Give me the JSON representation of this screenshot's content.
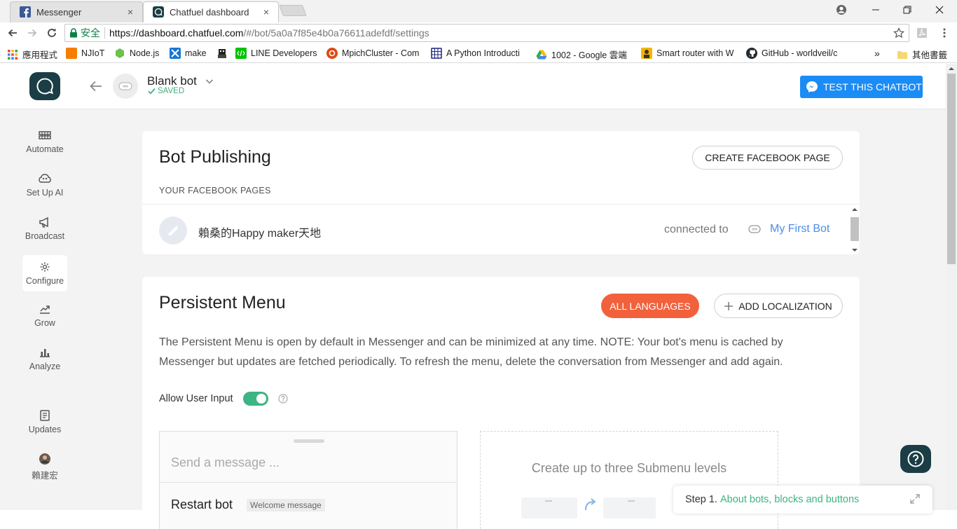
{
  "browser": {
    "tabs": [
      {
        "title": "Messenger",
        "close": "×",
        "active": false
      },
      {
        "title": "Chatfuel dashboard",
        "close": "×",
        "active": true
      }
    ],
    "address": {
      "secure_label": "安全",
      "url_host": "https://dashboard.chatfuel.com",
      "url_rest": "/#/bot/5a0a7f85e4b0a76611adefdf/settings"
    },
    "bookmarks": [
      {
        "label": "應用程式",
        "icon": "apps-grid-icon",
        "color": "#e8453c"
      },
      {
        "label": "NJIoT",
        "icon": "blogger-icon",
        "color": "#f57d00"
      },
      {
        "label": "Node.js",
        "icon": "nodejs-icon",
        "color": "#6cc24a"
      },
      {
        "label": "make",
        "icon": "bookmark-blue-icon",
        "color": "#1976d2"
      },
      {
        "label": "",
        "icon": "pixel-art-icon",
        "color": "#333333"
      },
      {
        "label": "LINE Developers",
        "icon": "line-icon",
        "color": "#00c300"
      },
      {
        "label": "MpichCluster - Com",
        "icon": "ubuntu-icon",
        "color": "#dd4814"
      },
      {
        "label": "A Python Introducti",
        "icon": "grid-doc-icon",
        "color": "#1a237e"
      },
      {
        "label": "1002 - Google 雲端",
        "icon": "google-drive-icon",
        "color": "#fbbc04"
      },
      {
        "label": "Smart router with W",
        "icon": "instructables-icon",
        "color": "#f4b400"
      },
      {
        "label": "GitHub - worldveil/c",
        "icon": "github-icon",
        "color": "#24292e"
      }
    ],
    "other_bookmarks": "其他書籤",
    "more_bookmarks": "»"
  },
  "header": {
    "bot_name": "Blank bot",
    "status": "SAVED",
    "test_button": "TEST THIS CHATBOT"
  },
  "sidebar": {
    "items": [
      {
        "label": "Automate",
        "icon": "automate-icon"
      },
      {
        "label": "Set Up AI",
        "icon": "ai-brain-icon"
      },
      {
        "label": "Broadcast",
        "icon": "megaphone-icon"
      },
      {
        "label": "Configure",
        "icon": "gear-icon",
        "active": true
      },
      {
        "label": "Grow",
        "icon": "grow-chart-icon"
      },
      {
        "label": "Analyze",
        "icon": "bar-chart-icon"
      },
      {
        "label": "Updates",
        "icon": "updates-icon"
      },
      {
        "label": "賴建宏",
        "icon": "user-avatar"
      }
    ]
  },
  "publishing": {
    "title": "Bot Publishing",
    "create_page_button": "CREATE FACEBOOK PAGE",
    "section_label": "YOUR FACEBOOK PAGES",
    "page": {
      "name": "賴桑的Happy maker天地",
      "connected_label": "connected to",
      "connected_bot": "My First Bot"
    }
  },
  "persistent_menu": {
    "title": "Persistent Menu",
    "all_languages_button": "ALL LANGUAGES",
    "add_localization_button": "ADD LOCALIZATION",
    "description": "The Persistent Menu is open by default in Messenger and can be minimized at any time. NOTE: Your bot's menu is cached by Messenger but updates are fetched periodically. To refresh the menu, delete the conversation from Messenger and add again.",
    "allow_user_input_label": "Allow User Input",
    "allow_user_input_on": true,
    "input_placeholder": "Send a message ...",
    "restart_item": "Restart bot",
    "restart_tag": "Welcome message",
    "submenu_hint": "Create up to three Submenu levels"
  },
  "step_panel": {
    "step": "Step 1.",
    "link": "About bots, blocks and buttons"
  },
  "colors": {
    "brand_dark": "#1b3d45",
    "messenger_blue": "#1b8cf5",
    "accent_orange": "#f2613b",
    "success_green": "#3db483",
    "link_blue": "#4d8de6"
  }
}
